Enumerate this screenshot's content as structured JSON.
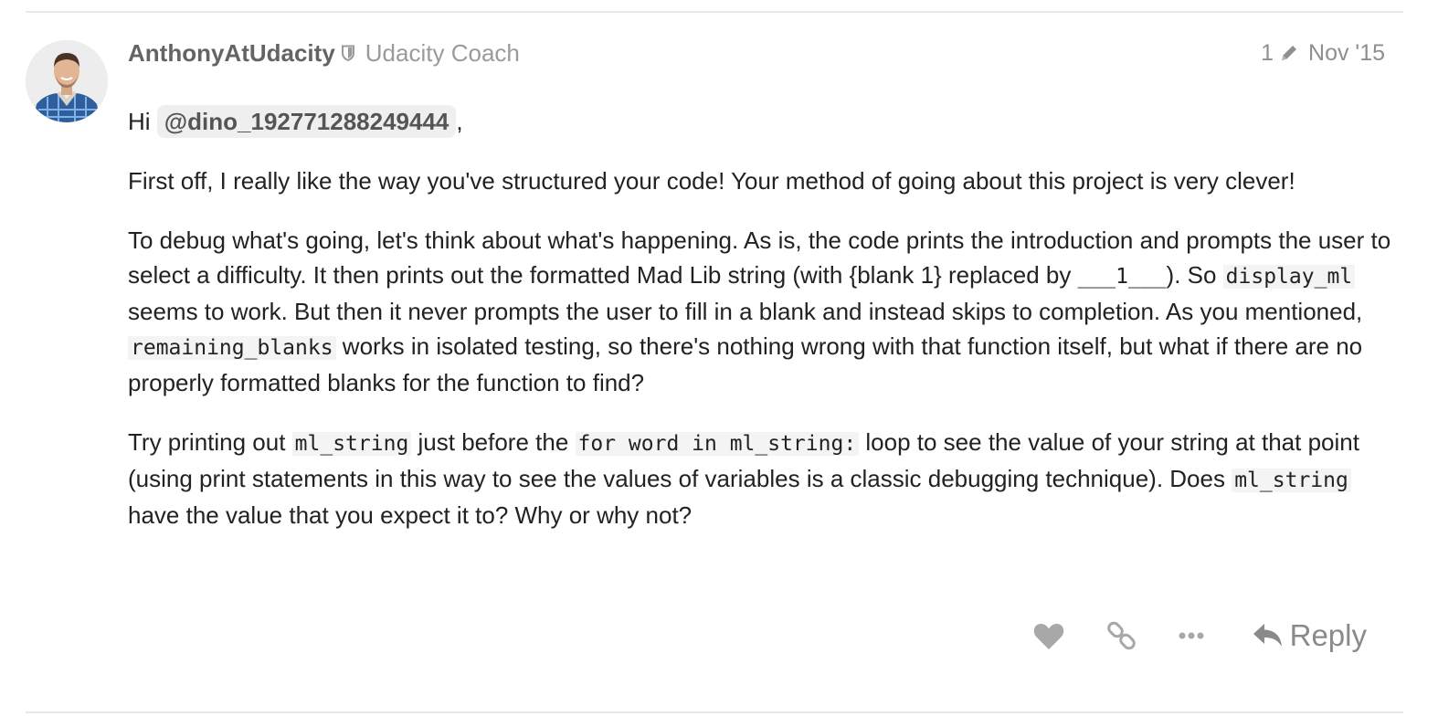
{
  "post": {
    "username": "AnthonyAtUdacity",
    "user_title": "Udacity Coach",
    "edit_count": "1",
    "date": "Nov '15",
    "greeting_prefix": "Hi",
    "mention": "@dino_192771288249444",
    "greeting_suffix": ",",
    "p1": "First off, I really like the way you've structured your code! Your method of going about this project is very clever!",
    "p2": {
      "t1": "To debug what's going, let's think about what's happening. As is, the code prints the introduction and prompts the user to select a difficulty. It then prints out the formatted Mad Lib string (with {blank 1} replaced by ",
      "c1": "___1___",
      "t2": "). So ",
      "c2": "display_ml",
      "t3": " seems to work. But then it never prompts the user to fill in a blank and instead skips to completion. As you mentioned, ",
      "c3": "remaining_blanks",
      "t4": " works in isolated testing, so there's nothing wrong with that function itself, but what if there are no properly formatted blanks for the function to find?"
    },
    "p3": {
      "t1": "Try printing out ",
      "c1": "ml_string",
      "t2": " just before the ",
      "c2": "for word in ml_string:",
      "t3": " loop to see the value of your string at that point (using print statements in this way to see the values of variables is a classic debugging technique). Does ",
      "c3": "ml_string",
      "t4": " have the value that you expect it to? Why or why not?"
    }
  },
  "actions": {
    "like_icon": "heart-icon",
    "link_icon": "link-icon",
    "more_icon": "ellipsis-icon",
    "reply_label": "Reply"
  },
  "colors": {
    "muted_text": "#9a9a9a",
    "body_text": "#222222",
    "mention_bg": "#efefef",
    "divider": "#e9e9e9"
  }
}
